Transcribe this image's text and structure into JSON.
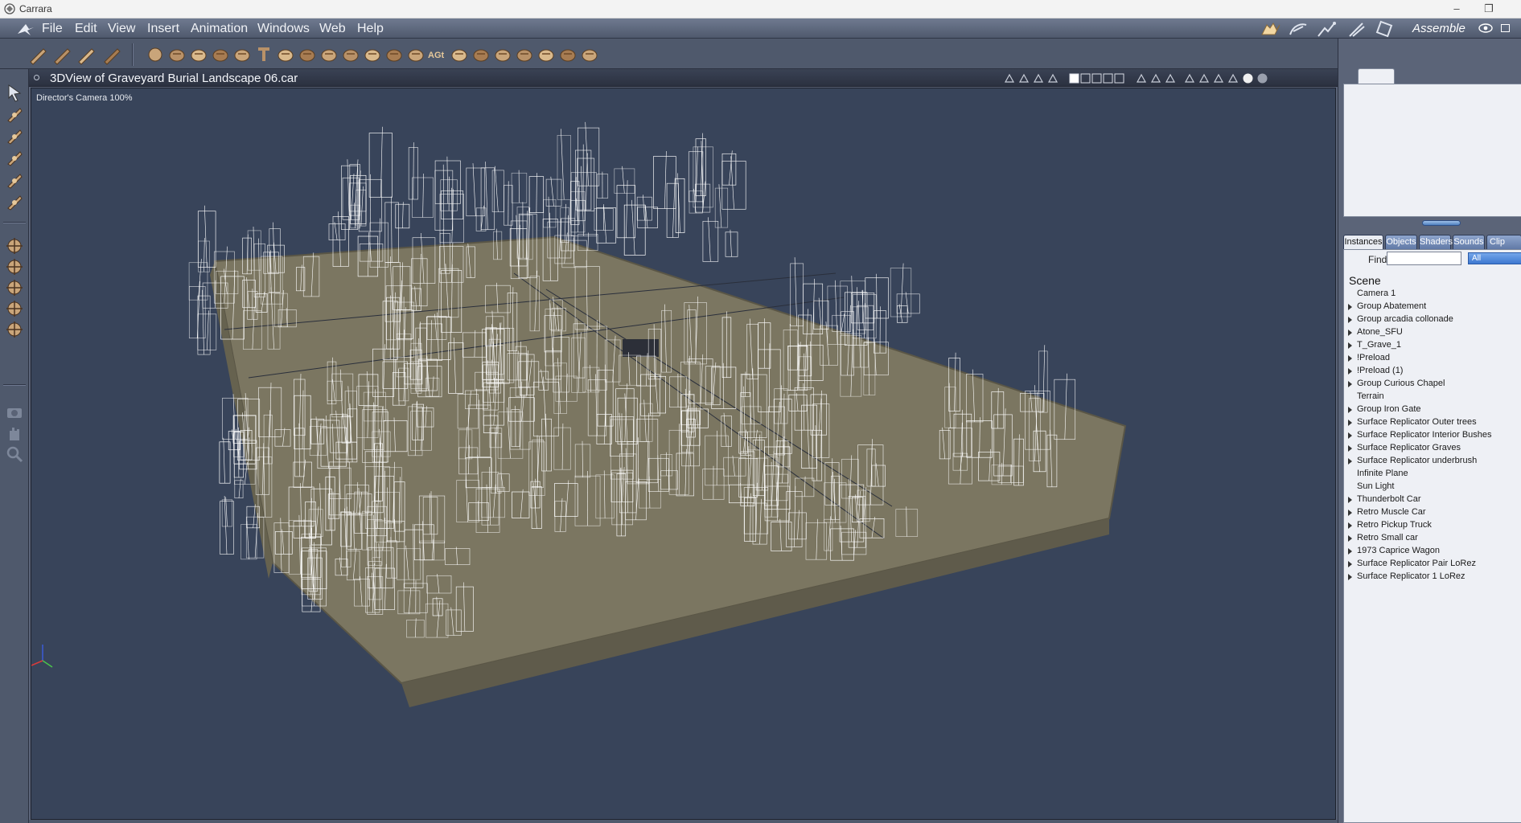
{
  "window": {
    "title": "Carrara",
    "controls": [
      "minimize",
      "restore",
      "close"
    ]
  },
  "menu": {
    "items": [
      "File",
      "Edit",
      "View",
      "Insert",
      "Animation",
      "Windows",
      "Web",
      "Help"
    ],
    "room_label": "Assemble"
  },
  "toolbar": {
    "tools": [
      "wand-brush-icon",
      "hand-icon",
      "figure-pose-icon",
      "shader-brush-icon",
      "sphere-icon",
      "goblet-icon",
      "globe-icon",
      "bone-icon",
      "ring-icon",
      "text-icon",
      "gear-icon",
      "terrain-icon",
      "star-icon",
      "cloud-icon",
      "flame-icon",
      "plant-icon",
      "fern-icon",
      "ago-text-icon",
      "bowl-icon",
      "stone-icon",
      "brush-icon",
      "particle-icon",
      "tree-icon",
      "target-icon",
      "wrench-icon"
    ],
    "ago_label": "AGt"
  },
  "left_tools": [
    "select-arrow-icon",
    "pick-direction-icon",
    "rotate-icon",
    "spin-icon",
    "pencil-icon",
    "paint-icon",
    "move-xyz-icon",
    "move-plane-icon",
    "move-axis-icon",
    "trackball-icon",
    "scale-icon",
    "camera-icon",
    "pan-hand-icon",
    "zoom-icon"
  ],
  "view": {
    "title": "3DView of Graveyard Burial Landscape 06.car",
    "camera_label": "Director's Camera 100%",
    "header_icons": [
      "tool-a-icon",
      "tool-b-icon",
      "tool-c-icon",
      "tool-d-icon",
      "layout-1-icon",
      "layout-2-icon",
      "layout-3-icon",
      "layout-4-icon",
      "layout-5-icon",
      "shield-1-icon",
      "shield-2-icon",
      "shield-3-icon",
      "nav-1-icon",
      "nav-2-icon",
      "cube-icon",
      "box-icon",
      "sphere-shade-1-icon",
      "sphere-shade-2-icon"
    ]
  },
  "right_panel": {
    "tabs": [
      "Instances",
      "Objects",
      "Shaders",
      "Sounds",
      "Clip"
    ],
    "active_tab": "Instances",
    "find_label": "Find:",
    "find_value": "",
    "filter_value": "All",
    "scene_root": "Scene",
    "items": [
      {
        "label": "Camera 1",
        "expandable": false
      },
      {
        "label": "Group Abatement",
        "expandable": true
      },
      {
        "label": "Group arcadia collonade",
        "expandable": true
      },
      {
        "label": "Atone_SFU",
        "expandable": true
      },
      {
        "label": "T_Grave_1",
        "expandable": true
      },
      {
        "label": "!Preload",
        "expandable": true
      },
      {
        "label": "!Preload (1)",
        "expandable": true
      },
      {
        "label": "Group Curious Chapel",
        "expandable": true
      },
      {
        "label": "Terrain",
        "expandable": false
      },
      {
        "label": "Group Iron Gate",
        "expandable": true
      },
      {
        "label": "Surface Replicator Outer trees",
        "expandable": true
      },
      {
        "label": "Surface Replicator Interior Bushes",
        "expandable": true
      },
      {
        "label": "Surface Replicator Graves",
        "expandable": true
      },
      {
        "label": "Surface Replicator underbrush",
        "expandable": true
      },
      {
        "label": "Infinite Plane",
        "expandable": false
      },
      {
        "label": "Sun Light",
        "expandable": false
      },
      {
        "label": "Thunderbolt Car",
        "expandable": true
      },
      {
        "label": "Retro Muscle Car",
        "expandable": true
      },
      {
        "label": "Retro Pickup Truck",
        "expandable": true
      },
      {
        "label": "Retro Small car",
        "expandable": true
      },
      {
        "label": "1973 Caprice Wagon",
        "expandable": true
      },
      {
        "label": "Surface Replicator Pair LoRez",
        "expandable": true
      },
      {
        "label": "Surface Replicator 1 LoRez",
        "expandable": true
      }
    ]
  },
  "colors": {
    "ui_base": "#5b6478",
    "toolbar": "#4f596c",
    "viewport_bg": "#38445a",
    "terrain": "#7b7661",
    "wireframe": "#ffffff",
    "panel_bg": "#eef0f5",
    "accent_blue": "#3d78d0"
  }
}
